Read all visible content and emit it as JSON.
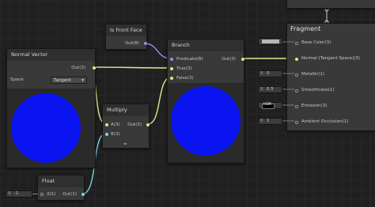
{
  "nodes": {
    "normal_vector": {
      "title": "Normal Vector",
      "output_label": "Out(3)",
      "space_label": "Space",
      "space_value": "Tangent"
    },
    "is_front_face": {
      "title": "Is Front Face",
      "output_label": "Out(B)"
    },
    "branch": {
      "title": "Branch",
      "input_predicate": "Predicate(B)",
      "input_true": "True(3)",
      "input_false": "False(3)",
      "output_label": "Out(3)"
    },
    "multiply": {
      "title": "Multiply",
      "input_a": "A(3)",
      "input_b": "B(3)",
      "output_label": "Out(3)",
      "collapse_glyph": "⌄"
    },
    "float": {
      "title": "Float",
      "field_x_label": "X",
      "field_x_value": "-1",
      "input_label": "X(1)",
      "output_label": "Out(1)"
    }
  },
  "fragment": {
    "title": "Fragment",
    "rows": [
      {
        "label": "Base Color(3)",
        "ext_type": "color",
        "ext_color": "#b5b5b5"
      },
      {
        "label": "Normal (Tangent Space)(3)",
        "ext_type": "none"
      },
      {
        "label": "Metallic(1)",
        "ext_type": "float",
        "ext_x": "X",
        "ext_value": "0"
      },
      {
        "label": "Smoothness(1)",
        "ext_type": "float",
        "ext_x": "X",
        "ext_value": "0.5"
      },
      {
        "label": "Emission(3)",
        "ext_type": "hdr",
        "ext_value": "HDR"
      },
      {
        "label": "Ambient Occlusion(1)",
        "ext_type": "float",
        "ext_x": "X",
        "ext_value": "1"
      }
    ]
  },
  "colors": {
    "wire_vector3": "#e6e68a",
    "wire_boolean": "#9c8cf0",
    "wire_float": "#7fd2e8",
    "preview_sphere": "#0a14f0",
    "background": "#202020"
  }
}
